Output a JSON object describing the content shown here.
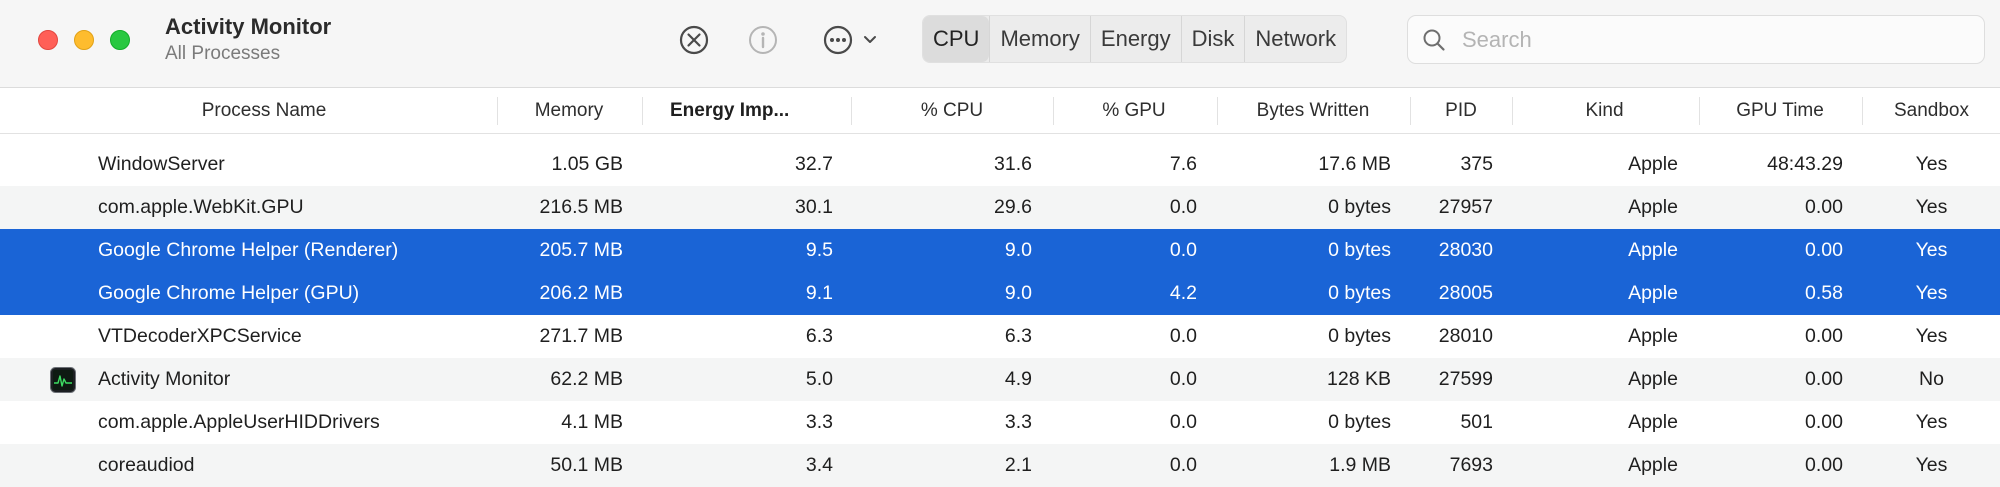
{
  "window": {
    "title": "Activity Monitor",
    "subtitle": "All Processes"
  },
  "toolbar": {
    "stop_icon": "stop-process-icon",
    "info_icon": "info-icon",
    "more_icon": "more-options-icon",
    "tabs": [
      {
        "label": "CPU",
        "active": true
      },
      {
        "label": "Memory",
        "active": false
      },
      {
        "label": "Energy",
        "active": false
      },
      {
        "label": "Disk",
        "active": false
      },
      {
        "label": "Network",
        "active": false
      }
    ]
  },
  "search": {
    "placeholder": "Search",
    "value": ""
  },
  "table": {
    "columns": [
      "Process Name",
      "Memory",
      "Energy Imp...",
      "% CPU",
      "% GPU",
      "Bytes Written",
      "PID",
      "Kind",
      "GPU Time",
      "Sandbox"
    ],
    "sorted_column": "Energy Imp...",
    "sort_direction": "descending",
    "rows": [
      {
        "name": "WindowServer",
        "memory": "1.05 GB",
        "energy": "32.7",
        "cpu": "31.6",
        "gpu": "7.6",
        "bytes_written": "17.6 MB",
        "pid": "375",
        "kind": "Apple",
        "gpu_time": "48:43.29",
        "sandbox": "Yes",
        "selected": false
      },
      {
        "name": "com.apple.WebKit.GPU",
        "memory": "216.5 MB",
        "energy": "30.1",
        "cpu": "29.6",
        "gpu": "0.0",
        "bytes_written": "0 bytes",
        "pid": "27957",
        "kind": "Apple",
        "gpu_time": "0.00",
        "sandbox": "Yes",
        "selected": false
      },
      {
        "name": "Google Chrome Helper (Renderer)",
        "memory": "205.7 MB",
        "energy": "9.5",
        "cpu": "9.0",
        "gpu": "0.0",
        "bytes_written": "0 bytes",
        "pid": "28030",
        "kind": "Apple",
        "gpu_time": "0.00",
        "sandbox": "Yes",
        "selected": true
      },
      {
        "name": "Google Chrome Helper (GPU)",
        "memory": "206.2 MB",
        "energy": "9.1",
        "cpu": "9.0",
        "gpu": "4.2",
        "bytes_written": "0 bytes",
        "pid": "28005",
        "kind": "Apple",
        "gpu_time": "0.58",
        "sandbox": "Yes",
        "selected": true
      },
      {
        "name": "VTDecoderXPCService",
        "memory": "271.7 MB",
        "energy": "6.3",
        "cpu": "6.3",
        "gpu": "0.0",
        "bytes_written": "0 bytes",
        "pid": "28010",
        "kind": "Apple",
        "gpu_time": "0.00",
        "sandbox": "Yes",
        "selected": false
      },
      {
        "name": "Activity Monitor",
        "memory": "62.2 MB",
        "energy": "5.0",
        "cpu": "4.9",
        "gpu": "0.0",
        "bytes_written": "128 KB",
        "pid": "27599",
        "kind": "Apple",
        "gpu_time": "0.00",
        "sandbox": "No",
        "selected": false,
        "icon": "activity-monitor-app-icon"
      },
      {
        "name": "com.apple.AppleUserHIDDrivers",
        "memory": "4.1 MB",
        "energy": "3.3",
        "cpu": "3.3",
        "gpu": "0.0",
        "bytes_written": "0 bytes",
        "pid": "501",
        "kind": "Apple",
        "gpu_time": "0.00",
        "sandbox": "Yes",
        "selected": false
      },
      {
        "name": "coreaudiod",
        "memory": "50.1 MB",
        "energy": "3.4",
        "cpu": "2.1",
        "gpu": "0.0",
        "bytes_written": "1.9 MB",
        "pid": "7693",
        "kind": "Apple",
        "gpu_time": "0.00",
        "sandbox": "Yes",
        "selected": false
      }
    ]
  },
  "colors": {
    "selection": "#1a64d6",
    "alt_row": "#f4f5f5",
    "traffic_close": "#ff5f57",
    "traffic_minimize": "#febc2e",
    "traffic_zoom": "#28c840"
  }
}
